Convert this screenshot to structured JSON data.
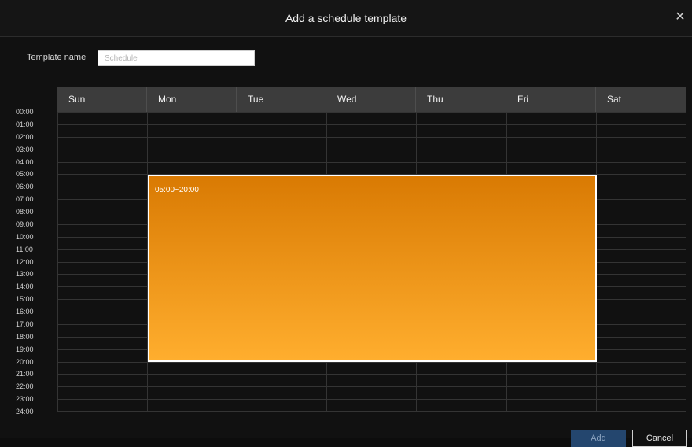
{
  "dialog": {
    "title": "Add a schedule template",
    "close_icon": "close-icon"
  },
  "form": {
    "name_label": "Template name",
    "name_placeholder": "Schedule",
    "name_value": ""
  },
  "schedule": {
    "days": [
      "Sun",
      "Mon",
      "Tue",
      "Wed",
      "Thu",
      "Fri",
      "Sat"
    ],
    "hours": [
      "00:00",
      "01:00",
      "02:00",
      "03:00",
      "04:00",
      "05:00",
      "06:00",
      "07:00",
      "08:00",
      "09:00",
      "10:00",
      "11:00",
      "12:00",
      "13:00",
      "14:00",
      "15:00",
      "16:00",
      "17:00",
      "18:00",
      "19:00",
      "20:00",
      "21:00",
      "22:00",
      "23:00",
      "24:00"
    ],
    "block": {
      "label": "05:00~20:00",
      "start_day": "Mon",
      "end_day": "Fri",
      "start_time": "05:00",
      "end_time": "20:00",
      "color_top": "#d97a03",
      "color_bottom": "#ffae2e"
    }
  },
  "footer": {
    "add_label": "Add",
    "cancel_label": "Cancel"
  }
}
